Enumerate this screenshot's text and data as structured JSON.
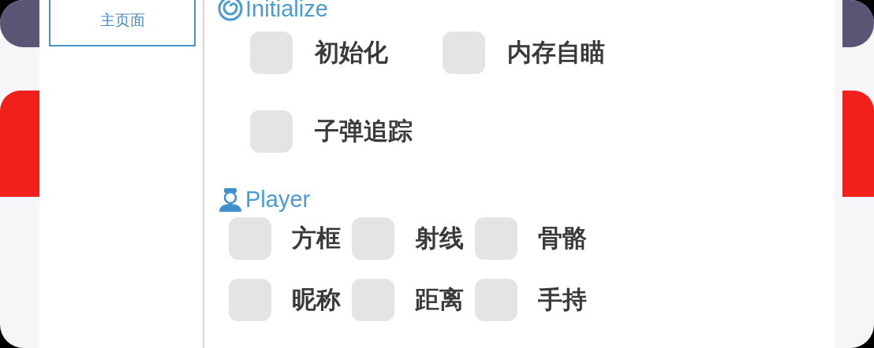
{
  "sidebar": {
    "items": [
      {
        "label": "主页面",
        "selected": true
      }
    ]
  },
  "sections": [
    {
      "title": "Initialize",
      "options": [
        {
          "label": "初始化",
          "checked": false
        },
        {
          "label": "内存自瞄",
          "checked": false
        },
        {
          "label": "子弹追踪",
          "checked": false
        }
      ]
    },
    {
      "title": "Player",
      "options": [
        {
          "label": "方框",
          "checked": false
        },
        {
          "label": "射线",
          "checked": false
        },
        {
          "label": "骨骼",
          "checked": false
        },
        {
          "label": "昵称",
          "checked": false
        },
        {
          "label": "距离",
          "checked": false
        },
        {
          "label": "手持",
          "checked": false
        }
      ]
    }
  ]
}
